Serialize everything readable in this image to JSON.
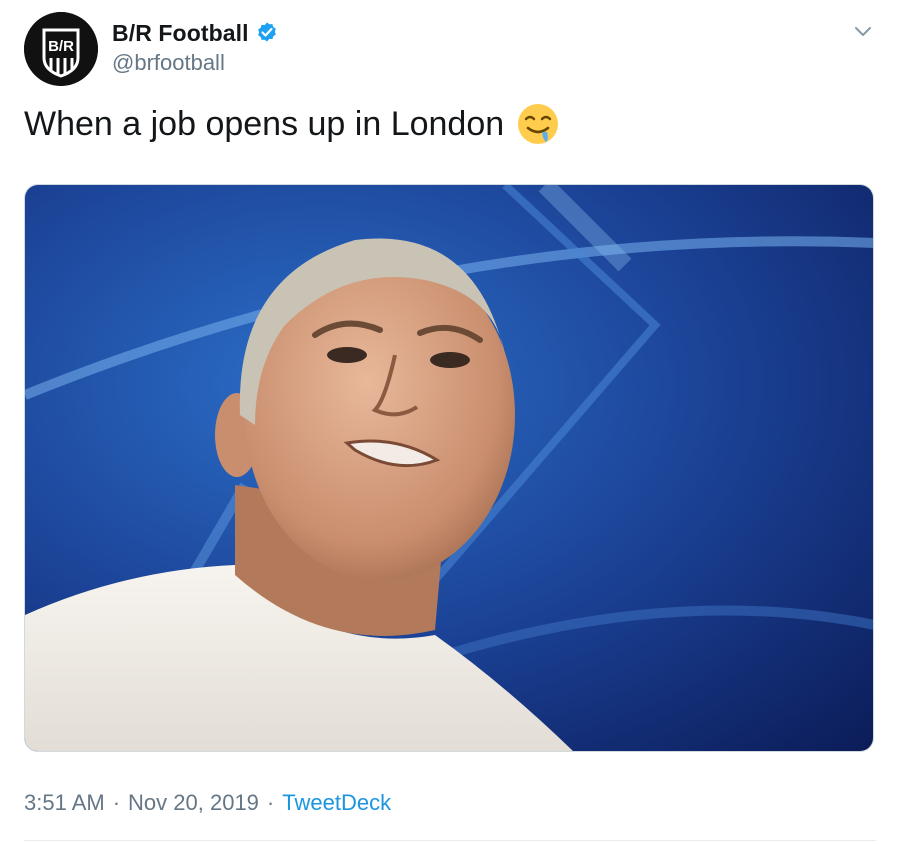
{
  "tweet": {
    "display_name": "B/R Football",
    "handle": "@brfootball",
    "verified": true,
    "text": "When a job opens up in London",
    "emoji": "drooling-face-emoji",
    "media_description_icon": "photo",
    "timestamp": "3:51 AM",
    "separator": "·",
    "date": "Nov 20, 2019",
    "source": "TweetDeck"
  },
  "avatar": {
    "logo_text": "B/R"
  },
  "colors": {
    "link": "#1b95e0",
    "secondary_text": "#657786",
    "primary_text": "#14171a",
    "verified_badge": "#1da1f2"
  }
}
